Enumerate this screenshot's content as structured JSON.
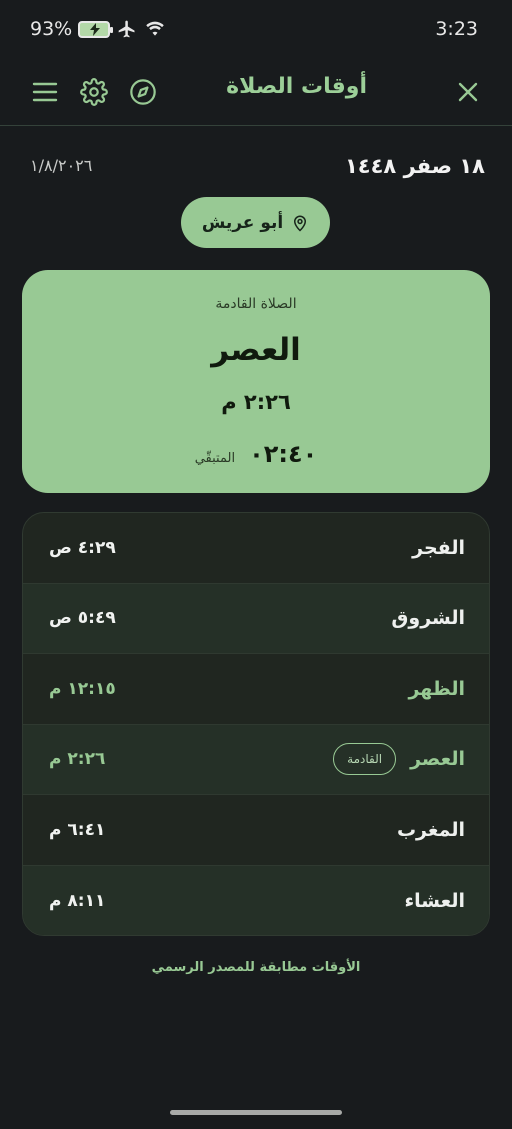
{
  "status_bar": {
    "battery": "93%",
    "time": "3:23",
    "icons": [
      "battery-charging-icon",
      "airplane-icon",
      "wifi-icon"
    ]
  },
  "header": {
    "title": "أوقات الصلاة",
    "icons": [
      "menu-icon",
      "gear-icon",
      "compass-icon",
      "close-icon"
    ]
  },
  "dates": {
    "hijri": "١٨ صفر ١٤٤٨",
    "gregorian": "١/٨/٢٠٢٦"
  },
  "city": {
    "name": "أبو عريش",
    "icon": "location-pin-icon"
  },
  "next_prayer": {
    "label": "الصلاة القادمة",
    "name": "العصر",
    "time": "٢:٢٦ م",
    "countdown": "٠٢:٤٠",
    "remaining_label": "المتبقّي"
  },
  "prayers": [
    {
      "name": "الفجر",
      "time": "٤:٢٩ ص",
      "style": "normal"
    },
    {
      "name": "الشروق",
      "time": "٥:٤٩ ص",
      "style": "normal"
    },
    {
      "name": "الظهر",
      "time": "١٢:١٥ م",
      "style": "green"
    },
    {
      "name": "العصر",
      "time": "٢:٢٦ م",
      "style": "green",
      "badge": "القادمة"
    },
    {
      "name": "المغرب",
      "time": "٦:٤١ م",
      "style": "normal"
    },
    {
      "name": "العشاء",
      "time": "٨:١١ م",
      "style": "normal"
    }
  ],
  "footnote": "الأوقات مطابقة للمصدر الرسمي",
  "colors": {
    "background": "#181b1d",
    "accent": "#98c994",
    "card_text": "#101a0e",
    "list_bg": "#202620"
  }
}
